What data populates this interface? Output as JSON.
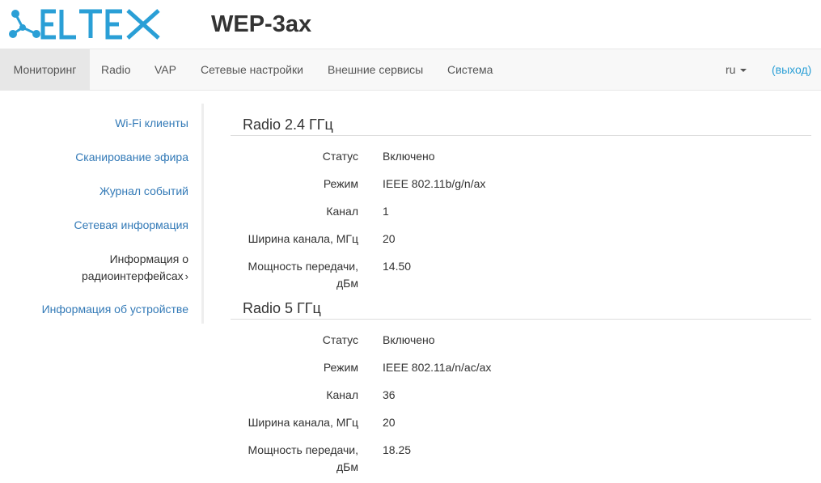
{
  "header": {
    "logo_text": "ELTEX",
    "model": "WEP-3ax"
  },
  "colors": {
    "brand": "#2a9fd6",
    "link": "#337ab7",
    "navbar_bg": "#f8f8f8",
    "nav_active_bg": "#e7e7e7"
  },
  "nav": {
    "items": [
      {
        "label": "Мониторинг",
        "active": true
      },
      {
        "label": "Radio"
      },
      {
        "label": "VAP"
      },
      {
        "label": "Сетевые настройки"
      },
      {
        "label": "Внешние сервисы"
      },
      {
        "label": "Система"
      }
    ],
    "language": "ru",
    "logout": "(выход)"
  },
  "sidebar": {
    "items": [
      {
        "label": "Wi-Fi клиенты"
      },
      {
        "label": "Сканирование эфира"
      },
      {
        "label": "Журнал событий"
      },
      {
        "label": "Сетевая информация"
      },
      {
        "label_line1": "Информация о",
        "label_line2": "радиоинтерфейсах",
        "current": true
      },
      {
        "label": "Информация об устройстве"
      }
    ]
  },
  "sections": [
    {
      "title": "Radio 2.4 ГГц",
      "rows": [
        {
          "label": "Статус",
          "value": "Включено"
        },
        {
          "label": "Режим",
          "value": "IEEE 802.11b/g/n/ax"
        },
        {
          "label": "Канал",
          "value": "1"
        },
        {
          "label": "Ширина канала, МГц",
          "value": "20"
        },
        {
          "label_line1": "Мощность передачи,",
          "label_line2": "дБм",
          "value": "14.50"
        }
      ]
    },
    {
      "title": "Radio 5 ГГц",
      "rows": [
        {
          "label": "Статус",
          "value": "Включено"
        },
        {
          "label": "Режим",
          "value": "IEEE 802.11a/n/ac/ax"
        },
        {
          "label": "Канал",
          "value": "36"
        },
        {
          "label": "Ширина канала, МГц",
          "value": "20"
        },
        {
          "label_line1": "Мощность передачи,",
          "label_line2": "дБм",
          "value": "18.25"
        }
      ]
    }
  ]
}
